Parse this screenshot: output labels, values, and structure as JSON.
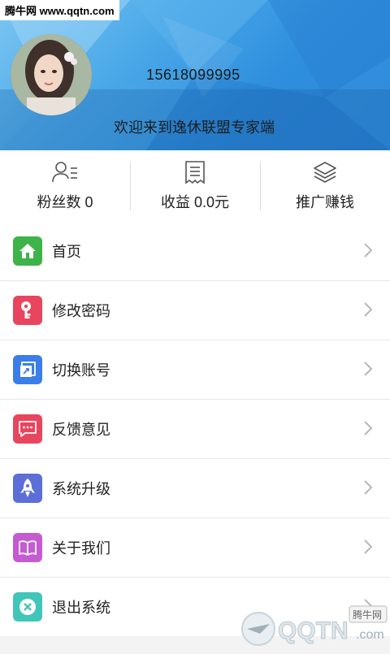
{
  "watermark_top": "腾牛网 www.qqtn.com",
  "profile": {
    "phone": "15618099995",
    "welcome": "欢迎来到逸休联盟专家端"
  },
  "stats": [
    {
      "icon": "user-list-icon",
      "label": "粉丝数 0"
    },
    {
      "icon": "receipt-icon",
      "label": "收益 0.0元"
    },
    {
      "icon": "layers-icon",
      "label": "推广赚钱"
    }
  ],
  "menu": [
    {
      "label": "首页",
      "icon": "home-icon",
      "color": "#3db34a"
    },
    {
      "label": "修改密码",
      "icon": "key-icon",
      "color": "#e8455e"
    },
    {
      "label": "切换账号",
      "icon": "switch-account-icon",
      "color": "#3b7de9"
    },
    {
      "label": "反馈意见",
      "icon": "chat-bubble-icon",
      "color": "#e8455e"
    },
    {
      "label": "系统升级",
      "icon": "rocket-icon",
      "color": "#5b6fd6"
    },
    {
      "label": "关于我们",
      "icon": "book-icon",
      "color": "#c45bd1"
    },
    {
      "label": "退出系统",
      "icon": "close-circle-icon",
      "color": "#3fc6b8"
    }
  ],
  "watermark_br": {
    "brand": "QQTN",
    "suffix": ".com",
    "badge": "腾牛网"
  }
}
